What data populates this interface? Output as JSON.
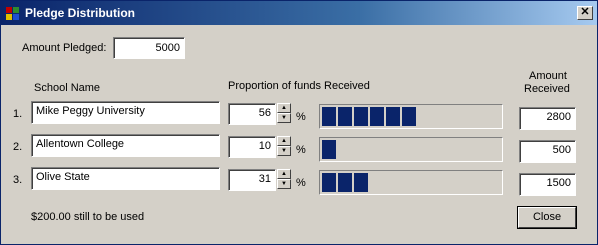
{
  "window": {
    "title": "Pledge Distribution",
    "close_glyph": "✕"
  },
  "pledged": {
    "label": "Amount Pledged:",
    "value": "5000"
  },
  "headers": {
    "school": "School Name",
    "proportion": "Proportion of funds Received",
    "amount_line1": "Amount",
    "amount_line2": "Received"
  },
  "rows": [
    {
      "index": "1.",
      "school": "Mike Peggy University",
      "percent": "56",
      "percent_sign": "%",
      "amount": "2800",
      "progress": 0.56
    },
    {
      "index": "2.",
      "school": "Allentown College",
      "percent": "10",
      "percent_sign": "%",
      "amount": "500",
      "progress": 0.1
    },
    {
      "index": "3.",
      "school": "Olive State",
      "percent": "31",
      "percent_sign": "%",
      "amount": "1500",
      "progress": 0.31
    }
  ],
  "status": "$200.00 still to be used",
  "close_button": "Close",
  "colors": {
    "progress_fill": "#0a246a",
    "titlebar_start": "#0a246a",
    "titlebar_end": "#a6caf0",
    "face": "#d4d0c8"
  },
  "icons": {
    "app": "app-icon",
    "spin_up": "▲",
    "spin_down": "▼"
  }
}
